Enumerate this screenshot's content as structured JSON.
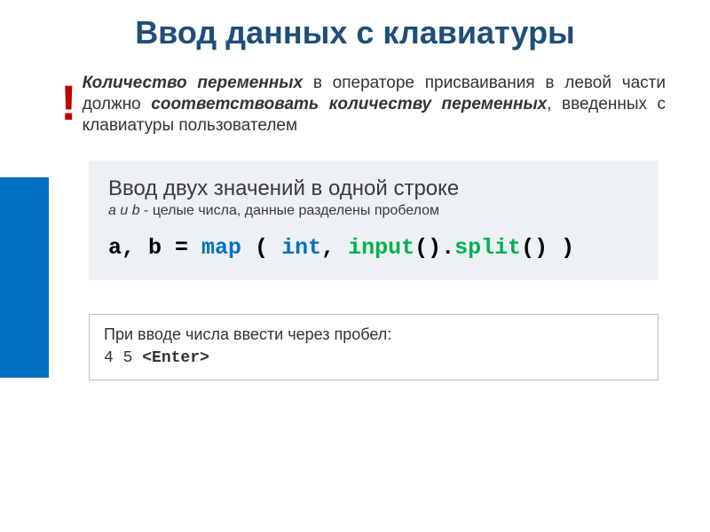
{
  "title": "Ввод данных с клавиатуры",
  "bang": "!",
  "note": {
    "part1_bold": "Количество переменных",
    "part2": " в операторе присваивания в левой части должно ",
    "part3_bold": "соответствовать количеству переменных",
    "part4": ", введенных с клавиатуры пользователем"
  },
  "card": {
    "title": "Ввод двух значений в одной строке",
    "sub_ital": "a и b",
    "sub_rest": " - целые числа, данные разделены пробелом"
  },
  "code": {
    "p1": "a, b = ",
    "map": "map",
    "p2": " ( ",
    "int": "int",
    "p3": ", ",
    "input": "input",
    "p4": "().",
    "split": "split",
    "p5": "() )"
  },
  "bottom": {
    "line1": "При вводе числа ввести через пробел:",
    "mono": "4 5 ",
    "enter": "<Enter>"
  }
}
